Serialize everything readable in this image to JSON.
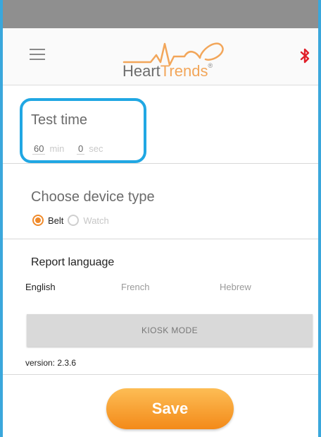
{
  "header": {
    "logo_main": "Heart",
    "logo_accent": "Trends",
    "logo_mark": "®",
    "menu_icon": "hamburger-menu-icon",
    "bluetooth_icon": "bluetooth-icon",
    "bluetooth_color": "#e0202a"
  },
  "test_time": {
    "title": "Test time",
    "minutes_value": "60",
    "minutes_unit": "min",
    "seconds_value": "0",
    "seconds_unit": "sec",
    "highlight_color": "#20a7e3"
  },
  "device_type": {
    "title": "Choose device type",
    "options": [
      {
        "label": "Belt",
        "selected": true
      },
      {
        "label": "Watch",
        "selected": false
      }
    ],
    "accent_color": "#f08a2a"
  },
  "report_language": {
    "title": "Report language",
    "options": [
      "English",
      "French",
      "Hebrew"
    ],
    "selected": "English"
  },
  "kiosk_button": "KIOSK MODE",
  "version": "version: 2.3.6",
  "save_button": "Save"
}
